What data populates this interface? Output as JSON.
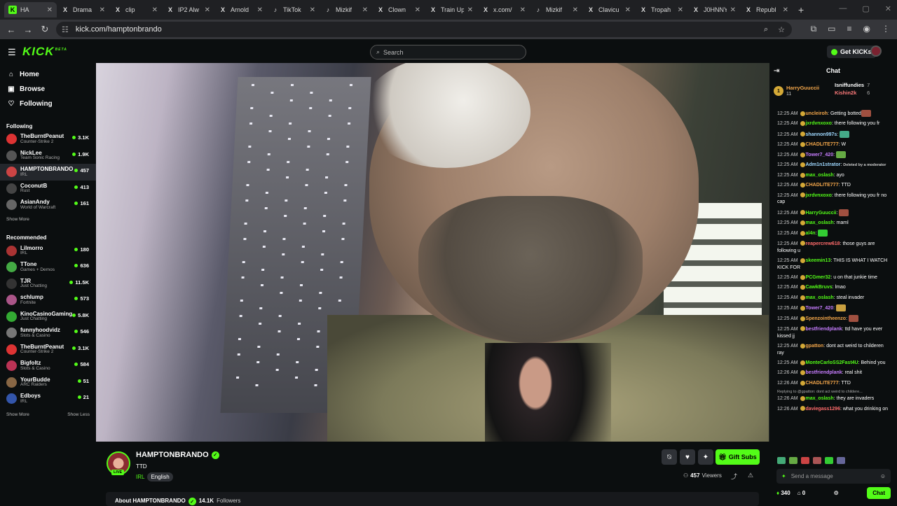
{
  "browser": {
    "tabs": [
      {
        "label": "HA",
        "icon": "K",
        "color": "#53fc18",
        "active": true
      },
      {
        "label": "Drama",
        "icon": "X",
        "color": "#ddd",
        "active": false
      },
      {
        "label": "clip",
        "icon": "X",
        "color": "#ddd",
        "active": false
      },
      {
        "label": "IP2 Alw",
        "icon": "X",
        "color": "#ddd",
        "active": false
      },
      {
        "label": "Arnold",
        "icon": "X",
        "color": "#ddd",
        "active": false
      },
      {
        "label": "TikTok",
        "icon": "♪",
        "color": "#ddd",
        "active": false
      },
      {
        "label": "Mizkif",
        "icon": "♪",
        "color": "#ddd",
        "active": false
      },
      {
        "label": "Clown",
        "icon": "X",
        "color": "#ddd",
        "active": false
      },
      {
        "label": "Train Up",
        "icon": "X",
        "color": "#ddd",
        "active": false
      },
      {
        "label": "x.com/",
        "icon": "X",
        "color": "#ddd",
        "active": false
      },
      {
        "label": "Mizkif",
        "icon": "♪",
        "color": "#ddd",
        "active": false
      },
      {
        "label": "Clavicu",
        "icon": "X",
        "color": "#ddd",
        "active": false
      },
      {
        "label": "Tropah",
        "icon": "X",
        "color": "#ddd",
        "active": false
      },
      {
        "label": "J0HNNY",
        "icon": "X",
        "color": "#ddd",
        "active": false
      },
      {
        "label": "Republ",
        "icon": "X",
        "color": "#ddd",
        "active": false
      }
    ],
    "url": "kick.com/hamptonbrando"
  },
  "header": {
    "logo": "KICK",
    "logo_sup": "BETA",
    "search_placeholder": "Search",
    "get_kicks": "Get KICKs"
  },
  "sidebar": {
    "nav": [
      {
        "label": "Home",
        "icon": "⌂"
      },
      {
        "label": "Browse",
        "icon": "▣"
      },
      {
        "label": "Following",
        "icon": "♡"
      }
    ],
    "following_title": "Following",
    "following": [
      {
        "name": "TheBurntPeanut",
        "cat": "Counter-Strike 2",
        "viewers": "3.1K",
        "color": "#d33"
      },
      {
        "name": "NickLee",
        "cat": "Team Sonic Racing",
        "viewers": "1.9K",
        "color": "#555"
      },
      {
        "name": "HAMPTONBRANDO",
        "cat": "IRL",
        "viewers": "457",
        "color": "#c44",
        "active": true
      },
      {
        "name": "CoconutB",
        "cat": "Rust",
        "viewers": "413",
        "color": "#444"
      },
      {
        "name": "AsianAndy",
        "cat": "World of Warcraft",
        "viewers": "161",
        "color": "#666"
      }
    ],
    "show_more": "Show More",
    "recommended_title": "Recommended",
    "recommended": [
      {
        "name": "Lilmorro",
        "cat": "IRL",
        "viewers": "180",
        "color": "#a33"
      },
      {
        "name": "TTone",
        "cat": "Games + Demos",
        "viewers": "636",
        "color": "#4a4"
      },
      {
        "name": "TJR",
        "cat": "Just Chatting",
        "viewers": "11.5K",
        "color": "#333"
      },
      {
        "name": "schlump",
        "cat": "Fortnite",
        "viewers": "573",
        "color": "#a58"
      },
      {
        "name": "KinoCasinoGaming",
        "cat": "Just Chatting",
        "viewers": "5.8K",
        "color": "#3a3"
      },
      {
        "name": "funnyhoodvidz",
        "cat": "Slots & Casino",
        "viewers": "546",
        "color": "#777"
      },
      {
        "name": "TheBurntPeanut",
        "cat": "Counter-Strike 2",
        "viewers": "3.1K",
        "color": "#d33"
      },
      {
        "name": "Bigfoltz",
        "cat": "Slots & Casino",
        "viewers": "584",
        "color": "#b35"
      },
      {
        "name": "YourBudde",
        "cat": "ARC Raiders",
        "viewers": "51",
        "color": "#864"
      },
      {
        "name": "Edboys",
        "cat": "IRL",
        "viewers": "21",
        "color": "#35a"
      }
    ],
    "show_more2": "Show More",
    "show_less": "Show Less"
  },
  "stream": {
    "name": "HAMPTONBRANDO",
    "title": "TTD",
    "category": "IRL",
    "language": "English",
    "live": "LIVE",
    "gift_subs": "Gift Subs",
    "viewers": "457",
    "viewers_label": "Viewers",
    "about_prefix": "About HAMPTONBRANDO",
    "followers": "14.1K",
    "followers_label": "Followers"
  },
  "chat": {
    "title": "Chat",
    "top_gifter": {
      "rank": "1",
      "name": "HarryGuuccii",
      "count": "11"
    },
    "gifters": [
      {
        "name": "Isniffundies",
        "count": "7"
      },
      {
        "name": "Kishin2k",
        "count": "6"
      }
    ],
    "messages": [
      {
        "time": "12:25 AM",
        "user": "uncleiroh",
        "color": "#f3a64a",
        "text": "Getting botted",
        "emote": "#a05040"
      },
      {
        "time": "12:25 AM",
        "user": "jxrdvnxoxo",
        "color": "#53fc18",
        "text": "there following you fr"
      },
      {
        "time": "12:25 AM",
        "user": "shannon997s",
        "color": "#9fd8ff",
        "text": "",
        "emote": "#4a8"
      },
      {
        "time": "12:25 AM",
        "user": "CHADLITE777",
        "color": "#f3a64a",
        "text": "W"
      },
      {
        "time": "12:25 AM",
        "user": "Tower7_420",
        "color": "#c77dff",
        "text": "",
        "emote": "#6a4"
      },
      {
        "time": "12:25 AM",
        "user": "Adm1n1strator",
        "color": "#9fd8ff",
        "text": "",
        "deleted": "Deleted by a moderator"
      },
      {
        "time": "12:25 AM",
        "user": "max_oslash",
        "color": "#53fc18",
        "text": "ayo"
      },
      {
        "time": "12:25 AM",
        "user": "CHADLITE777",
        "color": "#f3a64a",
        "text": "TTD"
      },
      {
        "time": "12:25 AM",
        "user": "jxrdvnxoxo",
        "color": "#53fc18",
        "text": "there following you fr no cap"
      },
      {
        "time": "12:25 AM",
        "user": "HarryGuuccii",
        "color": "#53fc18",
        "text": "",
        "emote": "#a05040"
      },
      {
        "time": "12:25 AM",
        "user": "max_oslash",
        "color": "#53fc18",
        "text": "maml"
      },
      {
        "time": "12:25 AM",
        "user": "al4n",
        "color": "#53fc18",
        "text": "",
        "emote": "#3c3"
      },
      {
        "time": "12:25 AM",
        "user": "reapercrew618",
        "color": "#ff6b6b",
        "text": "those guys are following u"
      },
      {
        "time": "12:25 AM",
        "user": "skeemin13",
        "color": "#53fc18",
        "text": "THIS IS WHAT I WATCH KICK FOR"
      },
      {
        "time": "12:25 AM",
        "user": "PCGmer32",
        "color": "#53fc18",
        "text": "u on that junkie time"
      },
      {
        "time": "12:25 AM",
        "user": "CawkBruvs",
        "color": "#53fc18",
        "text": "lmao"
      },
      {
        "time": "12:25 AM",
        "user": "max_oslash",
        "color": "#53fc18",
        "text": "steal invader"
      },
      {
        "time": "12:25 AM",
        "user": "Tower7_420",
        "color": "#c77dff",
        "text": "",
        "emote": "#c9a040"
      },
      {
        "time": "12:25 AM",
        "user": "Spenzointheenzo",
        "color": "#f3a64a",
        "text": "",
        "emote": "#a05040"
      },
      {
        "time": "12:25 AM",
        "user": "bestfriendplank",
        "color": "#c77dff",
        "text": "ttd have you ever kissed jj"
      },
      {
        "time": "12:25 AM",
        "user": "gpatton",
        "color": "#f3a64a",
        "text": "dont act weird to childeren ray"
      },
      {
        "time": "12:25 AM",
        "user": "MonteCarloSS2Fast4U",
        "color": "#53fc18",
        "text": "Behind you"
      },
      {
        "time": "12:26 AM",
        "user": "bestfriendplank",
        "color": "#c77dff",
        "text": "real shit"
      },
      {
        "time": "12:26 AM",
        "user": "CHADLITE777",
        "color": "#f3a64a",
        "text": "TTD"
      },
      {
        "time": "12:26 AM",
        "user": "max_oslash",
        "color": "#53fc18",
        "text": "they are invaders",
        "reply": "Replying to @gpatton: dont act weird to childere..."
      },
      {
        "time": "12:26 AM",
        "user": "daviegass1296",
        "color": "#ff6b6b",
        "text": "what you drinking on"
      }
    ],
    "input_placeholder": "Send a message",
    "points": "340",
    "points2": "0",
    "chat_button": "Chat"
  }
}
